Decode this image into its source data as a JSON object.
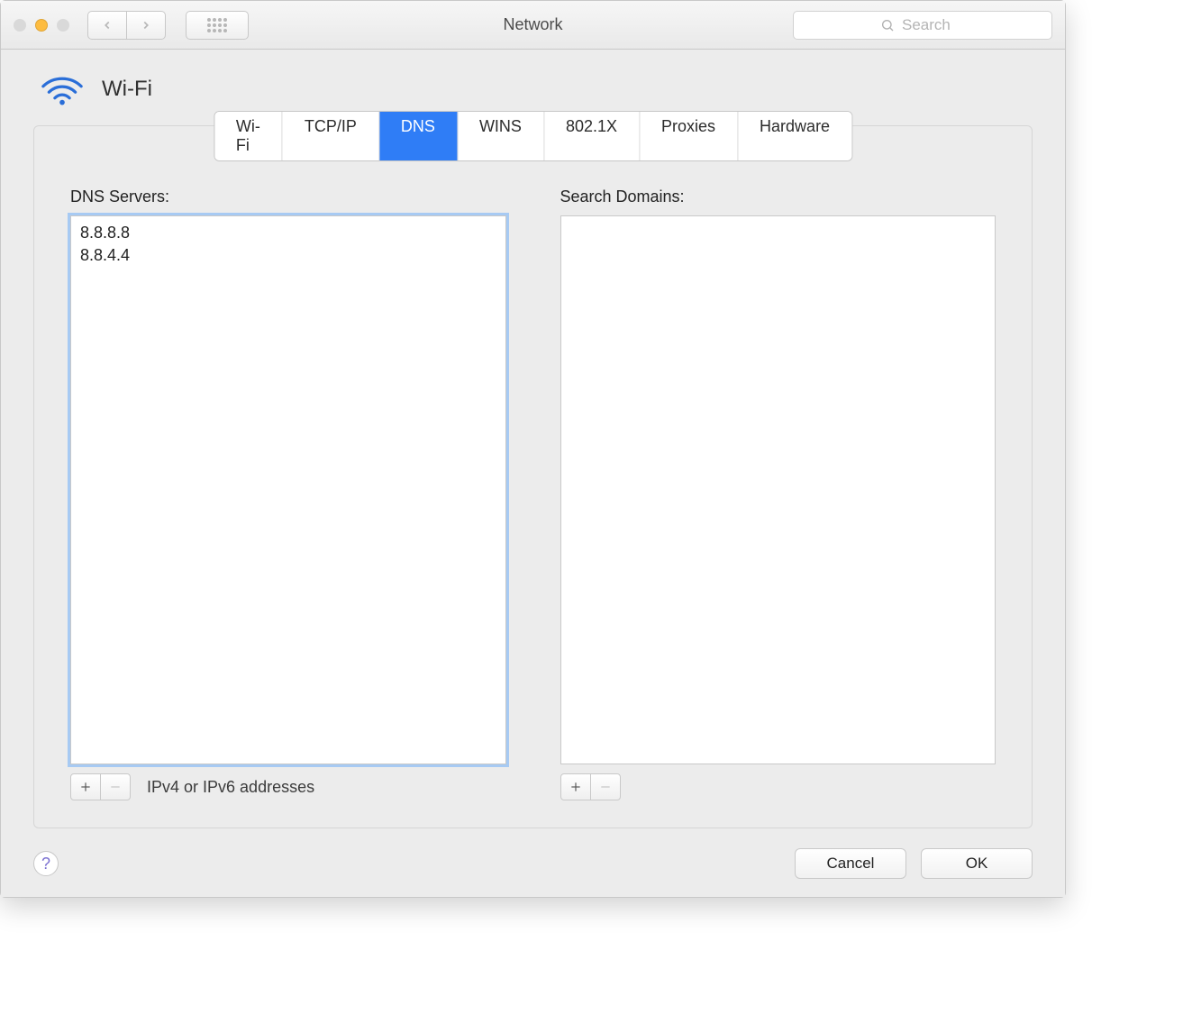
{
  "window": {
    "title": "Network"
  },
  "search": {
    "placeholder": "Search"
  },
  "header": {
    "interface": "Wi-Fi"
  },
  "tabs": [
    {
      "label": "Wi-Fi",
      "active": false
    },
    {
      "label": "TCP/IP",
      "active": false
    },
    {
      "label": "DNS",
      "active": true
    },
    {
      "label": "WINS",
      "active": false
    },
    {
      "label": "802.1X",
      "active": false
    },
    {
      "label": "Proxies",
      "active": false
    },
    {
      "label": "Hardware",
      "active": false
    }
  ],
  "dns": {
    "label": "DNS Servers:",
    "servers": [
      "8.8.8.8",
      "8.8.4.4"
    ],
    "hint": "IPv4 or IPv6 addresses"
  },
  "domains": {
    "label": "Search Domains:",
    "entries": []
  },
  "buttons": {
    "cancel": "Cancel",
    "ok": "OK"
  }
}
